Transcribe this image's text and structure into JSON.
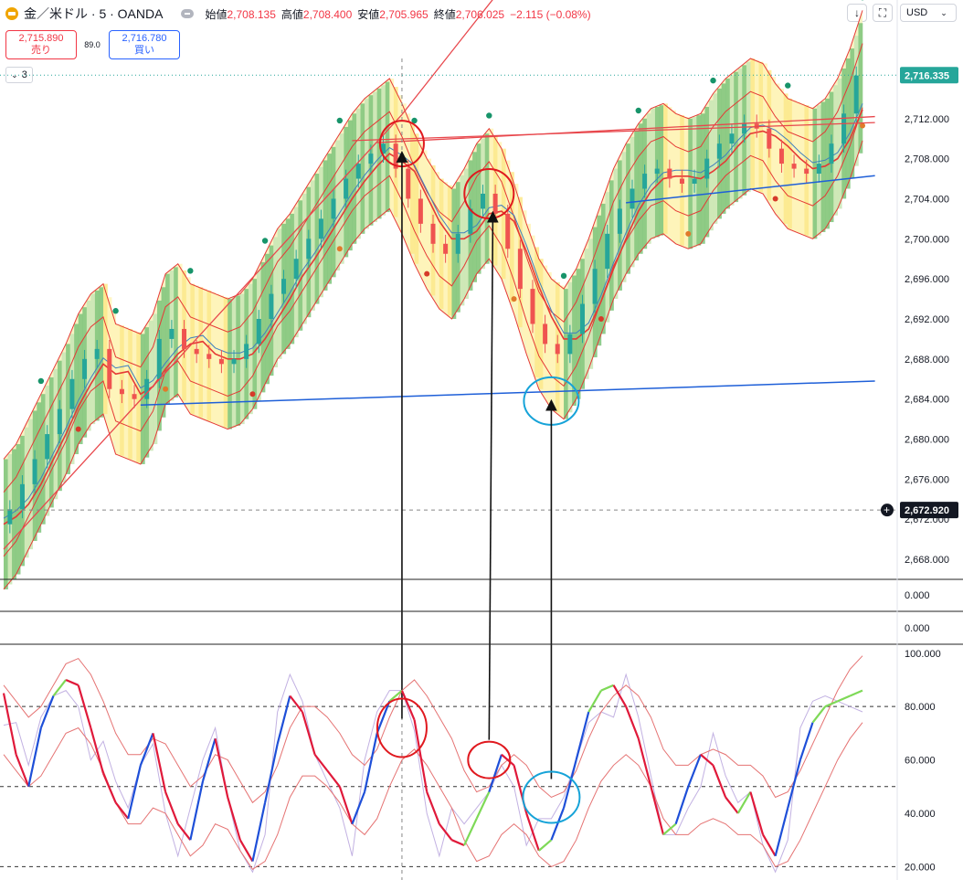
{
  "header": {
    "symbol": "金／米ドル · 5 · OANDA",
    "open_label": "始値",
    "open": "2,708.135",
    "high_label": "高値",
    "high": "2,708.400",
    "low_label": "安値",
    "low": "2,705.965",
    "close_label": "終値",
    "close": "2,706.025",
    "change": "−2.115 (−0.08%)",
    "currency": "USD"
  },
  "trade": {
    "sell_price": "2,715.890",
    "sell_label": "売り",
    "spread": "89.0",
    "buy_price": "2,716.780",
    "buy_label": "買い"
  },
  "indicators_count": "3",
  "price_axis": {
    "ticks": [
      "2,712.000",
      "2,708.000",
      "2,704.000",
      "2,700.000",
      "2,696.000",
      "2,692.000",
      "2,688.000",
      "2,684.000",
      "2,680.000",
      "2,676.000",
      "2,672.000",
      "2,668.000"
    ],
    "last_price_label": "2,716.335",
    "crosshair_label": "2,672.920"
  },
  "pane2_axis": {
    "value": "0.000"
  },
  "pane3_axis": {
    "value": "0.000"
  },
  "osc_axis": {
    "ticks": [
      "100.000",
      "80.000",
      "60.000",
      "40.000",
      "20.000"
    ]
  },
  "colors": {
    "bull": "#26a69a",
    "bear": "#ef5350",
    "band": "#e53935",
    "trend_blue": "#1e5fd8",
    "annotation_red": "#e0191f",
    "annotation_cyan": "#16a3d8",
    "stoch_purple": "#b39ddb",
    "last_price": "#26a69a"
  },
  "chart_data": {
    "type": "line",
    "title": "",
    "xlabel": "",
    "ylabel": "",
    "ylim": [
      2666,
      2718
    ],
    "series": [
      {
        "values": [
          2671.5,
          2673.0,
          2675.5,
          2678.0,
          2680.5,
          2683.0,
          2686.0,
          2688.0,
          2689.0,
          2685.0,
          2684.5,
          2684.0,
          2686.0,
          2690.0,
          2691.0,
          2689.0,
          2688.5,
          2688.0,
          2687.5,
          2688.0,
          2689.5,
          2692.0,
          2694.5,
          2696.0,
          2698.0,
          2700.0,
          2702.0,
          2704.0,
          2706.0,
          2707.5,
          2708.5,
          2709.5,
          2707.0,
          2704.0,
          2701.5,
          2699.5,
          2698.5,
          2700.5,
          2703.0,
          2704.5,
          2702.5,
          2699.0,
          2695.0,
          2691.5,
          2689.5,
          2688.5,
          2690.5,
          2693.5,
          2697.0,
          2700.5,
          2703.0,
          2705.0,
          2706.5,
          2707.0,
          2706.0,
          2705.5,
          2706.0,
          2708.0,
          2709.5,
          2710.5,
          2711.5,
          2711.0,
          2709.0,
          2707.5,
          2707.0,
          2706.5,
          2707.5,
          2709.5,
          2712.5,
          2716.3
        ]
      }
    ]
  },
  "osc_data": {
    "ylim": [
      15,
      103
    ],
    "k_values": [
      85,
      62,
      50,
      72,
      84,
      90,
      88,
      72,
      55,
      44,
      38,
      58,
      70,
      48,
      36,
      30,
      52,
      68,
      46,
      30,
      22,
      44,
      66,
      84,
      78,
      62,
      56,
      50,
      36,
      48,
      70,
      82,
      86,
      75,
      48,
      36,
      30,
      28,
      38,
      48,
      62,
      58,
      40,
      26,
      30,
      42,
      60,
      78,
      86,
      88,
      80,
      68,
      50,
      32,
      36,
      50,
      62,
      58,
      46,
      40,
      48,
      32,
      24,
      42,
      60,
      74,
      80,
      82,
      84,
      86
    ],
    "d_values": [
      78,
      72,
      66,
      70,
      78,
      86,
      88,
      82,
      72,
      60,
      52,
      52,
      58,
      56,
      48,
      40,
      44,
      52,
      50,
      42,
      34,
      38,
      48,
      62,
      70,
      70,
      66,
      60,
      52,
      48,
      54,
      66,
      76,
      80,
      74,
      66,
      58,
      46,
      38,
      40,
      48,
      52,
      48,
      40,
      36,
      38,
      46,
      58,
      68,
      74,
      78,
      74,
      66,
      54,
      48,
      48,
      52,
      54,
      52,
      48,
      48,
      44,
      36,
      38,
      46,
      56,
      66,
      76,
      84,
      90
    ]
  }
}
